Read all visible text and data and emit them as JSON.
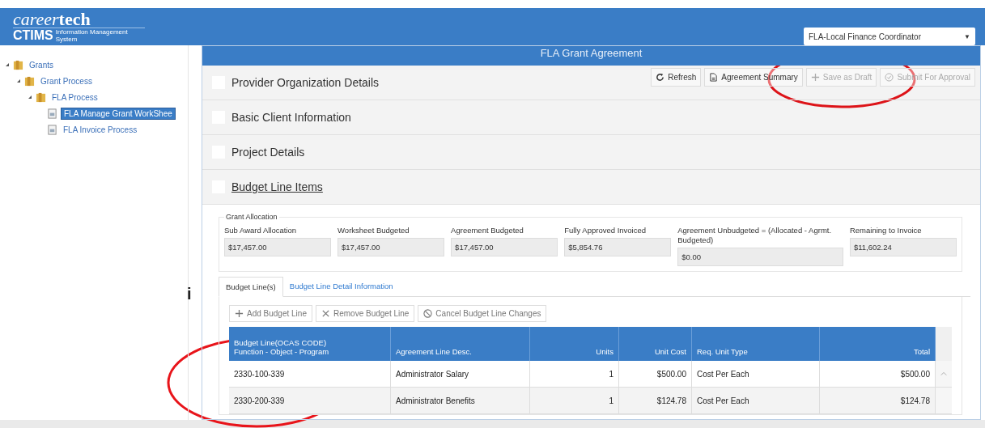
{
  "header": {
    "logo_top": "career",
    "logo_top_bold": "tech",
    "logo_main": "CTIMS",
    "logo_sub": "Information Management System",
    "role_select": "FLA-Local Finance Coordinator",
    "role_caret": "▼"
  },
  "tree": [
    {
      "label": "Grants",
      "kind": "folder",
      "selected": false,
      "expanded": true,
      "children": [
        {
          "label": "Grant Process",
          "kind": "folder",
          "selected": false,
          "expanded": true,
          "children": [
            {
              "label": "FLA Process",
              "kind": "folder",
              "selected": false,
              "expanded": true,
              "children": [
                {
                  "label": "FLA Manage Grant WorkShee",
                  "kind": "page",
                  "selected": true
                },
                {
                  "label": "FLA Invoice Process",
                  "kind": "page",
                  "selected": false
                }
              ]
            }
          ]
        }
      ]
    }
  ],
  "stray_mark": "i",
  "panel": {
    "title": "FLA Grant Agreement",
    "toolbar": [
      {
        "label": "Refresh",
        "disabled": false
      },
      {
        "label": "Agreement Summary",
        "disabled": false
      },
      {
        "label": "Save as Draft",
        "disabled": true
      },
      {
        "label": "Submit For Approval",
        "disabled": true
      }
    ],
    "sections": [
      {
        "title": "Provider Organization Details",
        "active": false,
        "checked": false
      },
      {
        "title": "Basic Client Information",
        "active": false,
        "checked": false
      },
      {
        "title": "Project Details",
        "active": false,
        "checked": false
      },
      {
        "title": "Budget Line Items",
        "active": true,
        "checked": false
      }
    ],
    "allocation": {
      "legend": "Grant Allocation",
      "fields": [
        {
          "label": "Sub Award Allocation",
          "value": "$17,457.00"
        },
        {
          "label": "Worksheet Budgeted",
          "value": "$17,457.00"
        },
        {
          "label": "Agreement Budgeted",
          "value": "$17,457.00"
        },
        {
          "label": "Fully Approved Invoiced",
          "value": "$5,854.76"
        },
        {
          "label": "Agreement Unbudgeted = (Allocated - Agrmt. Budgeted)",
          "value": "$0.00"
        },
        {
          "label": "Remaining to Invoice",
          "value": "$11,602.24"
        }
      ]
    },
    "tabs": [
      {
        "label": "Budget Line(s)",
        "selected": true
      },
      {
        "label": "Budget Line Detail Information",
        "selected": false
      }
    ],
    "line_actions": [
      {
        "label": "Add Budget Line"
      },
      {
        "label": "Remove Budget Line"
      },
      {
        "label": "Cancel Budget Line Changes"
      }
    ],
    "table": {
      "columns": [
        {
          "label": "Budget Line(OCAS CODE)\nFunction - Object - Program"
        },
        {
          "label": "Agreement Line Desc."
        },
        {
          "label": "Units"
        },
        {
          "label": "Unit Cost"
        },
        {
          "label": "Req. Unit Type"
        },
        {
          "label": "Total"
        }
      ],
      "rows": [
        [
          "2330-100-339",
          "Administrator Salary",
          "1",
          "$500.00",
          "Cost Per Each",
          "$500.00"
        ],
        [
          "2330-200-339",
          "Administrator Benefits",
          "1",
          "$124.78",
          "Cost Per Each",
          "$124.78"
        ]
      ]
    }
  }
}
